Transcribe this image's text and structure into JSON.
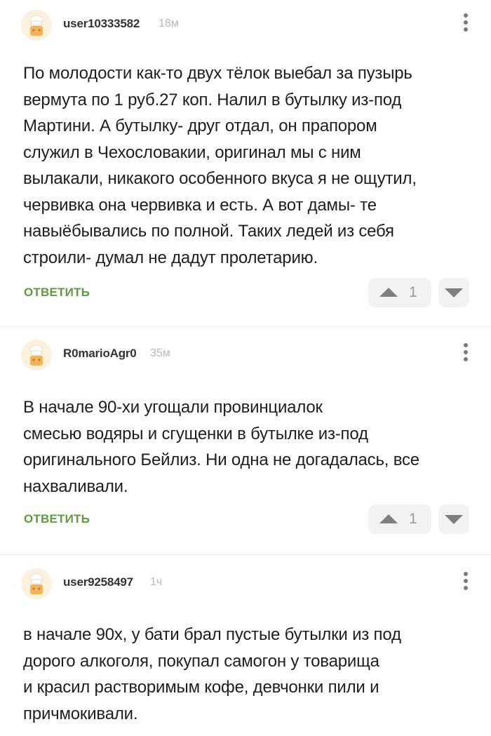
{
  "comments": [
    {
      "username": "user10333582",
      "time": "18м",
      "text": "По молодости как-то двух тёлок выебал за пузырь\nвермута по 1 руб.27 коп. Налил в бутылку из-под\nМартини. А бутылку- друг отдал, он прапором\nслужил в Чехословакии, оригинал мы с ним\nвылакали, никакого особенного вкуса я не ощутил,\nчервивка она червивка и есть. А вот дамы- те\nнавыёбывались по полной. Таких ледей из себя\nстроили- думал не дадут пролетарию.",
      "reply_label": "ОТВЕТИТЬ",
      "rating": "1"
    },
    {
      "username": "R0marioAgr0",
      "time": "35м",
      "text": "В начале 90-хи угощали провинциалок\nсмесью водяры и сгущенки в бутылке из-под\nоригинального Бейлиз. Ни одна не догадалась, все\nнахваливали.",
      "reply_label": "ОТВЕТИТЬ",
      "rating": "1"
    },
    {
      "username": "user9258497",
      "time": "1ч",
      "text": "в начале 90х, у бати брал пустые бутылки из под\nдорого алкоголя, покупал самогон у товарища\nи красил растворимым кофе, девчонки пили и\nпричмокивали."
    }
  ],
  "colors": {
    "reply_green": "#5e9b3f",
    "avatar_bg": "#fbf1dd",
    "vote_bg": "#f2f2f2"
  },
  "icons": {
    "menu": "more-vertical-icon",
    "upvote": "triangle-up-icon",
    "downvote": "triangle-down-icon",
    "avatar": "chef-avatar-icon"
  }
}
